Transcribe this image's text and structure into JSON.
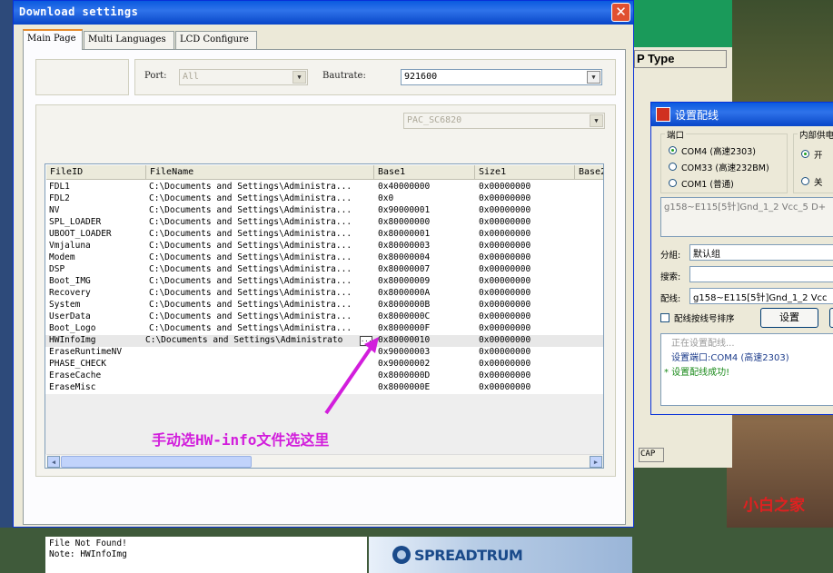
{
  "window": {
    "title": "Download settings",
    "close_glyph": "✕"
  },
  "tabs": [
    {
      "label": "Main Page"
    },
    {
      "label": "Multi Languages"
    },
    {
      "label": "LCD Configure"
    }
  ],
  "port": {
    "label": "Port:",
    "value": "All"
  },
  "baudrate": {
    "label": "Bautrate:",
    "value": "921600"
  },
  "product": {
    "value": "PAC_SC6820"
  },
  "table": {
    "columns": [
      "FileID",
      "FileName",
      "Base1",
      "Size1",
      "Base2"
    ],
    "rows": [
      [
        "FDL1",
        "C:\\Documents and Settings\\Administra...",
        "0x40000000",
        "0x00000000"
      ],
      [
        "FDL2",
        "C:\\Documents and Settings\\Administra...",
        "0x0",
        "0x00000000"
      ],
      [
        "NV",
        "C:\\Documents and Settings\\Administra...",
        "0x90000001",
        "0x00000000"
      ],
      [
        "SPL_LOADER",
        "C:\\Documents and Settings\\Administra...",
        "0x80000000",
        "0x00000000"
      ],
      [
        "UBOOT_LOADER",
        "C:\\Documents and Settings\\Administra...",
        "0x80000001",
        "0x00000000"
      ],
      [
        "Vmjaluna",
        "C:\\Documents and Settings\\Administra...",
        "0x80000003",
        "0x00000000"
      ],
      [
        "Modem",
        "C:\\Documents and Settings\\Administra...",
        "0x80000004",
        "0x00000000"
      ],
      [
        "DSP",
        "C:\\Documents and Settings\\Administra...",
        "0x80000007",
        "0x00000000"
      ],
      [
        "Boot_IMG",
        "C:\\Documents and Settings\\Administra...",
        "0x80000009",
        "0x00000000"
      ],
      [
        "Recovery",
        "C:\\Documents and Settings\\Administra...",
        "0x8000000A",
        "0x00000000"
      ],
      [
        "System",
        "C:\\Documents and Settings\\Administra...",
        "0x8000000B",
        "0x00000000"
      ],
      [
        "UserData",
        "C:\\Documents and Settings\\Administra...",
        "0x8000000C",
        "0x00000000"
      ],
      [
        "Boot_Logo",
        "C:\\Documents and Settings\\Administra...",
        "0x8000000F",
        "0x00000000"
      ],
      [
        "HWInfoImg",
        "C:\\Documents and Settings\\Administrato",
        "0x80000010",
        "0x00000000"
      ],
      [
        "EraseRuntimeNV",
        "",
        "0x90000003",
        "0x00000000"
      ],
      [
        "PHASE_CHECK",
        "",
        "0x90000002",
        "0x00000000"
      ],
      [
        "EraseCache",
        "",
        "0x8000000D",
        "0x00000000"
      ],
      [
        "EraseMisc",
        "",
        "0x8000000E",
        "0x00000000"
      ]
    ],
    "browse_glyph": "..."
  },
  "annotation": {
    "text": "手动选HW-info文件选这里",
    "color": "#d21edc"
  },
  "status": {
    "line1": "File Not Found!",
    "line2": "Note: HWInfoImg"
  },
  "logo": {
    "text": "SPREADTRUM"
  },
  "background": {
    "ptype_label": "P Type",
    "cap_label": "CAP"
  },
  "wiring_dialog": {
    "title": "设置配线",
    "port_group": "端口",
    "ports": [
      "COM4 (高速2303)",
      "COM33 (高速232BM)",
      "COM1 (普通)"
    ],
    "power_group": "内部供电",
    "power_on": "开",
    "power_off": "关",
    "preview_text": "g158~E115[5针]Gnd_1_2   Vcc_5   D+",
    "group_label": "分組:",
    "group_value": "默认组",
    "search_label": "搜索:",
    "search_value": "",
    "wire_label": "配线:",
    "wire_value": "g158~E115[5针]Gnd_1_2   Vcc",
    "sort_label": "配线按线号排序",
    "set_button": "设置",
    "log": [
      "正在设置配线...",
      "设置端口:COM4 (高速2303)",
      "* 设置配线成功!"
    ]
  },
  "watermark": "小白之家",
  "colors": {
    "titlebar": "#0a5adf",
    "annotation": "#d21edc",
    "watermark": "#e02020"
  }
}
